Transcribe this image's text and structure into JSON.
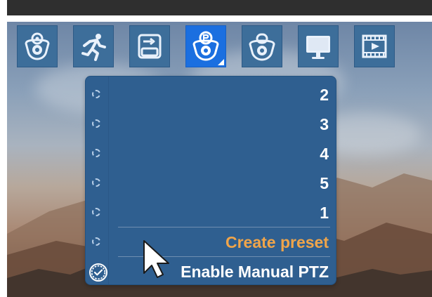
{
  "toolbar": {
    "tools": [
      {
        "name": "camera-settings-icon"
      },
      {
        "name": "motion-detection-icon"
      },
      {
        "name": "export-icon"
      },
      {
        "name": "ptz-presets-icon"
      },
      {
        "name": "camera-icon"
      },
      {
        "name": "monitor-icon"
      },
      {
        "name": "video-playback-icon"
      }
    ],
    "selected": "ptz-presets-icon"
  },
  "preset_menu": {
    "items": [
      {
        "label": "2"
      },
      {
        "label": "3"
      },
      {
        "label": "4"
      },
      {
        "label": "5"
      },
      {
        "label": "1"
      }
    ],
    "create_preset_label": "Create preset",
    "enable_manual_ptz_label": "Enable Manual PTZ",
    "enable_manual_ptz_checked": true
  },
  "colors": {
    "toolbar_button": "#3d6e9a",
    "toolbar_button_selected": "#1b6fe0",
    "menu_background": "#2f5f90",
    "create_preset_text": "#f0a54a"
  }
}
